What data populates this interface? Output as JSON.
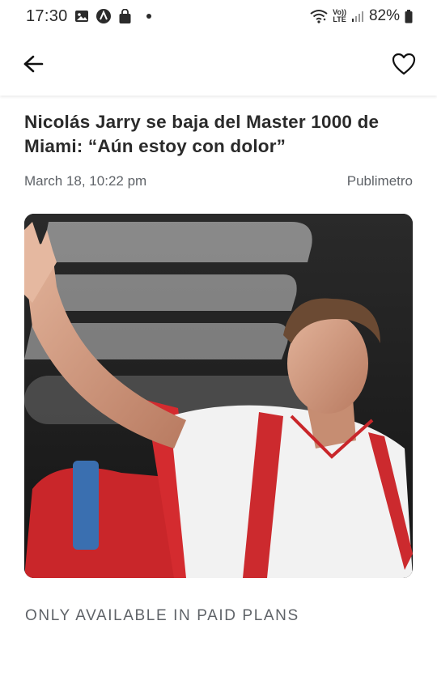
{
  "status_bar": {
    "time": "17:30",
    "battery": "82%",
    "notification_icons": [
      "gallery-icon",
      "app-icon",
      "shopping-bag-icon",
      "dot-icon"
    ],
    "system_icons": [
      "wifi-icon",
      "volte-icon",
      "signal-icon",
      "battery-icon"
    ],
    "network_label_top": "Vo))",
    "network_label_bottom": "LTE"
  },
  "app_bar": {
    "back_icon": "arrow-left-icon",
    "favorite_icon": "heart-outline-icon"
  },
  "article": {
    "title": "Nicolás Jarry se baja del Master 1000 de Miami: “Aún estoy con dolor”",
    "date": "March 18, 10:22 pm",
    "source": "Publimetro",
    "image_alt": "Tennis player waving, wearing white shirt and red racket bag"
  },
  "paywall": {
    "text": "ONLY AVAILABLE IN PAID PLANS"
  }
}
